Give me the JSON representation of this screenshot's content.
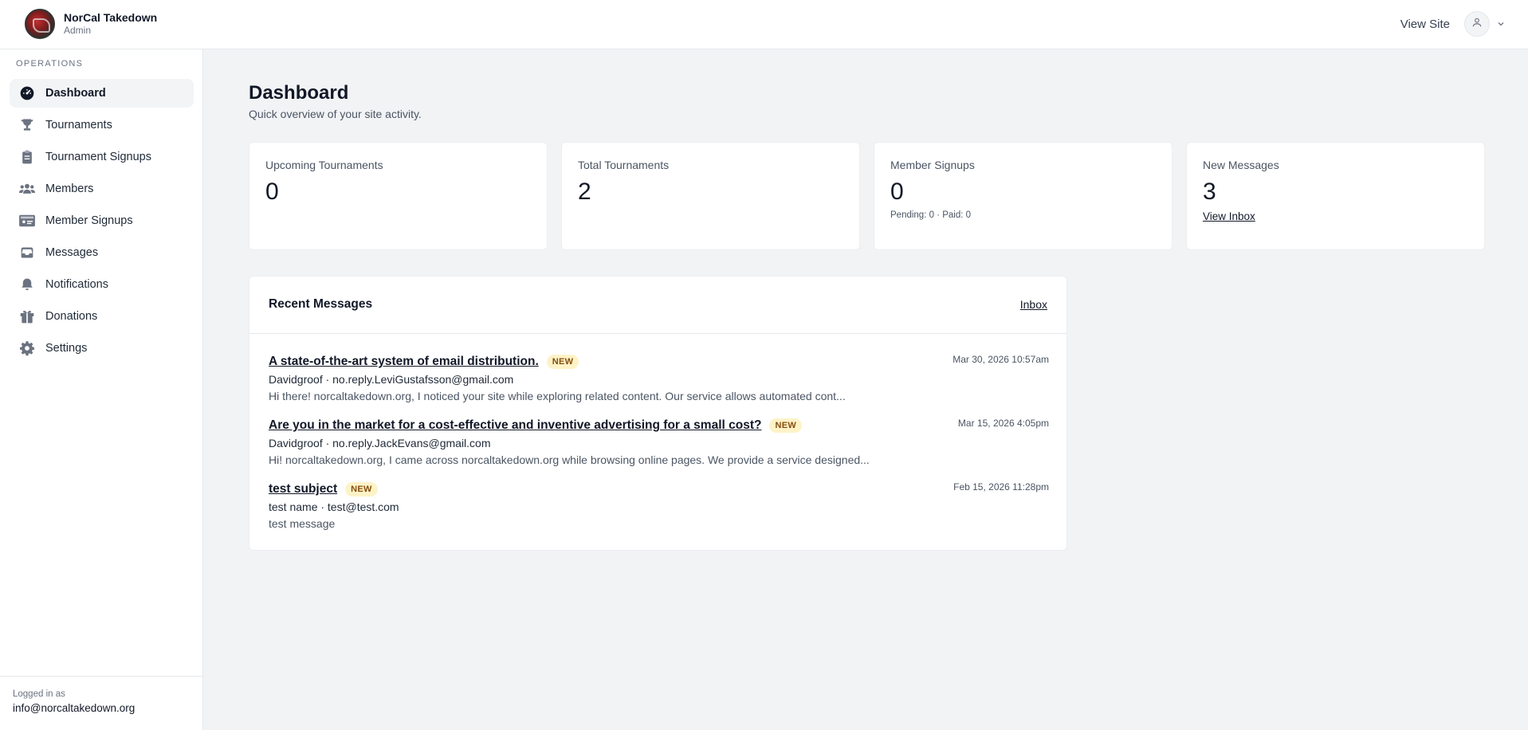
{
  "header": {
    "brand_name": "NorCal Takedown",
    "brand_role": "Admin",
    "view_site": "View Site"
  },
  "sidebar": {
    "section": "OPERATIONS",
    "items": [
      {
        "label": "Dashboard",
        "icon": "dashboard-gauge-icon",
        "active": true
      },
      {
        "label": "Tournaments",
        "icon": "trophy-icon"
      },
      {
        "label": "Tournament Signups",
        "icon": "clipboard-icon"
      },
      {
        "label": "Members",
        "icon": "users-icon"
      },
      {
        "label": "Member Signups",
        "icon": "id-card-icon"
      },
      {
        "label": "Messages",
        "icon": "inbox-icon"
      },
      {
        "label": "Notifications",
        "icon": "bell-icon"
      },
      {
        "label": "Donations",
        "icon": "gift-icon"
      },
      {
        "label": "Settings",
        "icon": "gear-icon"
      }
    ],
    "footer": {
      "logged_label": "Logged in as",
      "email": "info@norcaltakedown.org"
    }
  },
  "main": {
    "title": "Dashboard",
    "subtitle": "Quick overview of your site activity."
  },
  "stats": [
    {
      "label": "Upcoming Tournaments",
      "value": "0"
    },
    {
      "label": "Total Tournaments",
      "value": "2"
    },
    {
      "label": "Member Signups",
      "value": "0",
      "note": "Pending: 0 · Paid: 0"
    },
    {
      "label": "New Messages",
      "value": "3",
      "link": "View Inbox"
    }
  ],
  "recent_messages": {
    "title": "Recent Messages",
    "inbox_link": "Inbox",
    "items": [
      {
        "subject": "A state-of-the-art system of email distribution.",
        "badge": "NEW",
        "from": "Davidgroof · no.reply.LeviGustafsson@gmail.com",
        "preview": "Hi there! norcaltakedown.org, I noticed your site while exploring related content. Our service allows automated cont...",
        "date": "Mar 30, 2026 10:57am"
      },
      {
        "subject": "Are you in the market for a cost-effective and inventive advertising for a small cost?",
        "badge": "NEW",
        "from": "Davidgroof · no.reply.JackEvans@gmail.com",
        "preview": "Hi! norcaltakedown.org, I came across norcaltakedown.org while browsing online pages. We provide a service designed...",
        "date": "Mar 15, 2026 4:05pm"
      },
      {
        "subject": "test subject",
        "badge": "NEW",
        "from": "test name · test@test.com",
        "preview": "test message",
        "date": "Feb 15, 2026 11:28pm"
      }
    ]
  },
  "colors": {
    "background": "#f2f3f5",
    "surface": "#ffffff",
    "badge_bg": "#fef3c7",
    "badge_text": "#854d0e",
    "text_primary": "#111827",
    "text_muted": "#4b5563"
  }
}
